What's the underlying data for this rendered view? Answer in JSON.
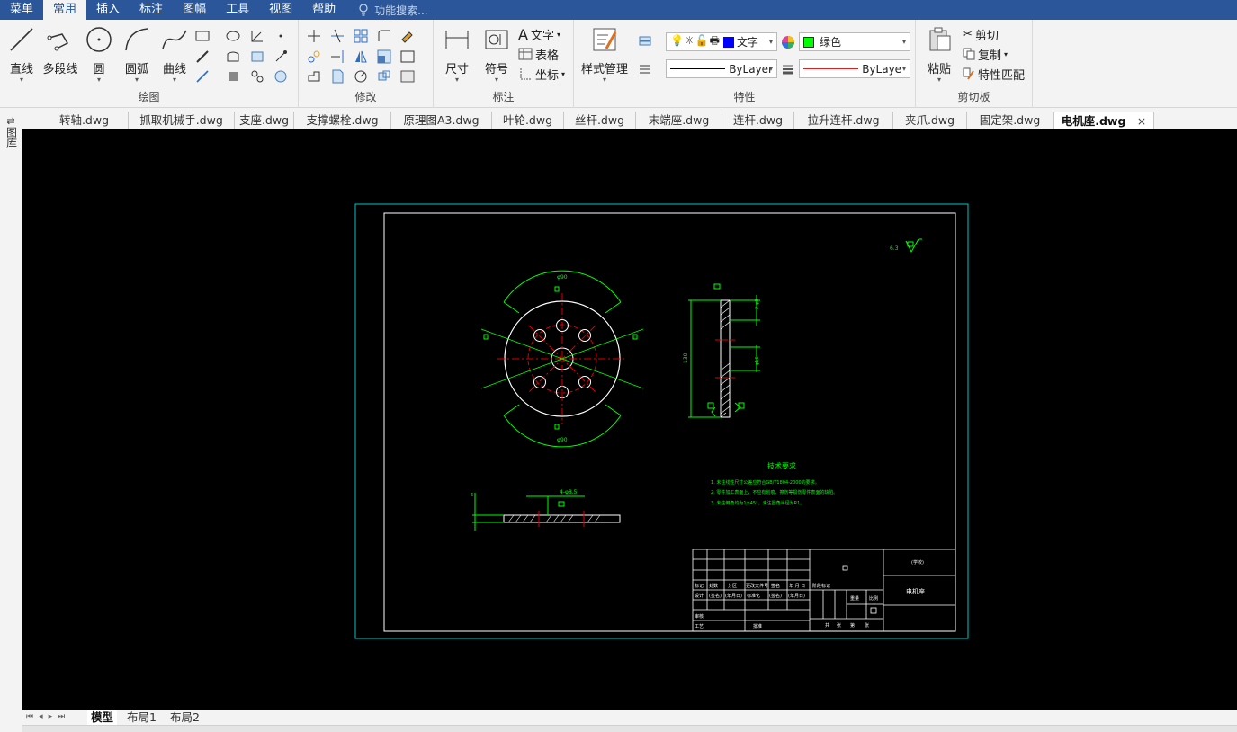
{
  "menu": {
    "items": [
      "菜单",
      "常用",
      "插入",
      "标注",
      "图幅",
      "工具",
      "视图",
      "帮助"
    ],
    "search_placeholder": "功能搜索..."
  },
  "ribbon": {
    "draw": {
      "label": "绘图",
      "line": "直线",
      "polyline": "多段线",
      "circle": "圆",
      "arc": "圆弧",
      "spline": "曲线"
    },
    "modify": {
      "label": "修改"
    },
    "annotate": {
      "label": "标注",
      "dimension": "尺寸",
      "symbol": "符号",
      "text": "文字",
      "table": "表格",
      "coord": "坐标"
    },
    "properties": {
      "label": "特性",
      "style_manager": "样式管理",
      "layer": "文字",
      "color": "绿色",
      "color_hex": "#00ff00",
      "linetype": "ByLayer",
      "lineweight": "ByLayer"
    },
    "clipboard": {
      "label": "剪切板",
      "paste": "粘贴",
      "cut": "剪切",
      "copy": "复制",
      "match": "特性匹配"
    }
  },
  "left_strip": {
    "label": "图库"
  },
  "doc_tabs": [
    "转轴.dwg",
    "抓取机械手.dwg",
    "支座.dwg",
    "支撑螺栓.dwg",
    "原理图A3.dwg",
    "叶轮.dwg",
    "丝杆.dwg",
    "末端座.dwg",
    "连杆.dwg",
    "拉升连杆.dwg",
    "夹爪.dwg",
    "固定架.dwg",
    "电机座.dwg"
  ],
  "active_doc": "电机座.dwg",
  "drawing": {
    "tech_title": "技术要求",
    "tech_notes": [
      "1. 未注线性尺寸公差应符合GB/T1804-2000的要求。",
      "2. 零件加工表面上，不应有划痕、擦伤等损伤零件表面的缺陷。",
      "3. 未注倒角均为1×45°，未注圆角半径为R1。"
    ],
    "part_name": "电机座",
    "dim_top": "φ90",
    "dim_bottom": "φ90",
    "dim_thickness": "4-φ8.5",
    "dim_height": "130",
    "dim_hole": "φ16",
    "dim_side": "2-φ8",
    "surface_mark": "6.3",
    "title_block_top": "(学校)",
    "tb_row1": [
      "标记",
      "处数",
      "分区",
      "更改文件号",
      "签名",
      "年 月 日"
    ],
    "tb_row2": [
      "设计",
      "(签名)",
      "(年月日)",
      "标准化",
      "(签名)",
      "(年月日)"
    ],
    "tb_row3": [
      "审核"
    ],
    "tb_row4": [
      "工艺",
      "批准"
    ],
    "tb_mid": [
      "阶段标记",
      "重量",
      "比例"
    ],
    "tb_sheet": [
      "共",
      "张",
      "第",
      "张"
    ]
  },
  "layout_tabs": [
    "模型",
    "布局1",
    "布局2"
  ],
  "active_layout": "模型"
}
